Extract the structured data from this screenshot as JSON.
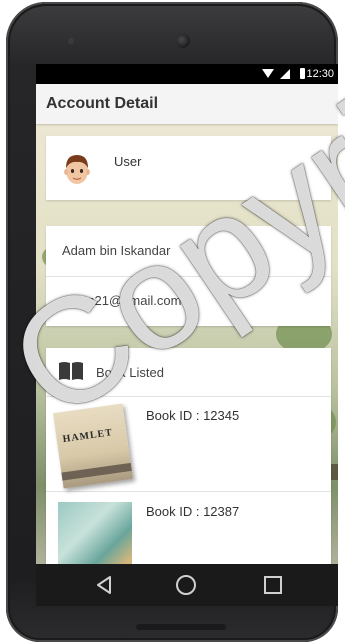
{
  "status_bar": {
    "time": "12:30"
  },
  "app_bar": {
    "title": "Account Detail"
  },
  "user_card": {
    "label": "User"
  },
  "account": {
    "name": "Adam bin Iskandar",
    "email": "adam21@gmail.com"
  },
  "books": {
    "header": "Book Listed",
    "items": [
      {
        "id_label": "Book ID : 12345",
        "cover_title": "HAMLET",
        "cover_icon": "book-cover-hamlet"
      },
      {
        "id_label": "Book ID : 12387",
        "cover_icon": "book-cover-illustrated"
      }
    ]
  },
  "nav": {
    "icons": [
      "back-icon",
      "home-icon",
      "recent-apps-icon"
    ]
  },
  "watermark": {
    "text": "Copyright"
  },
  "colors": {
    "accent": "#000000",
    "app_bar": "#f4f4f4",
    "nav_bar": "#1a1a1a"
  }
}
